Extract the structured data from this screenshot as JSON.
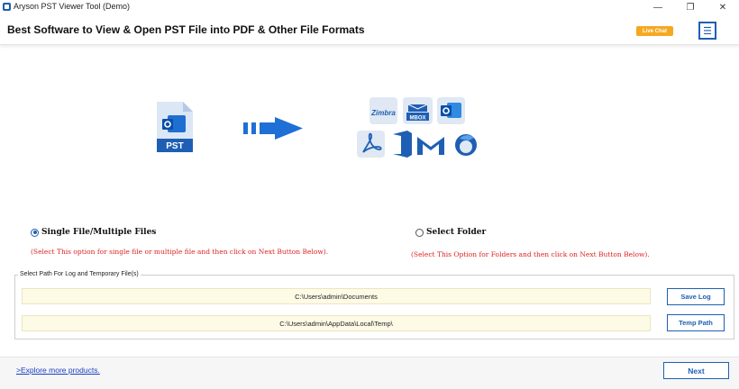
{
  "window": {
    "title": "Aryson PST Viewer Tool (Demo)",
    "minimize_glyph": "—",
    "maximize_glyph": "❐",
    "close_glyph": "✕"
  },
  "header": {
    "headline": "Best Software to View & Open PST File into PDF & Other File Formats",
    "live_chat_label": "Live Chat",
    "menu_glyph": "☰"
  },
  "hero": {
    "source_file_label": "PST",
    "format_icons": [
      "zimbra-icon",
      "mbox-icon",
      "outlook-icon",
      "pdf-icon",
      "office365-icon",
      "gmail-icon",
      "thunderbird-icon"
    ],
    "mbox_label": "MBOX",
    "zimbra_label": "Zimbra"
  },
  "options": {
    "single_label": "Single File/Multiple Files",
    "single_hint": "(Select This option for single file or multiple file and then click on Next Button Below).",
    "single_selected": true,
    "folder_label": "Select Folder",
    "folder_hint": "(Select This Option for Folders and then click on Next Button Below).",
    "folder_selected": false
  },
  "paths": {
    "legend": "Select Path For Log and Temporary File(s)",
    "log_path": "C:\\Users\\admin\\Documents",
    "save_log_label": "Save Log",
    "temp_path": "C:\\Users\\admin\\AppData\\Local\\Temp\\",
    "temp_path_label": "Temp Path"
  },
  "footer": {
    "explore_label": ">Explore more products.",
    "next_label": "Next"
  },
  "colors": {
    "accent": "#1e5fb4",
    "hint_red": "#d22222",
    "live_chat": "#f6a821",
    "path_bg": "#fdfbe6"
  }
}
